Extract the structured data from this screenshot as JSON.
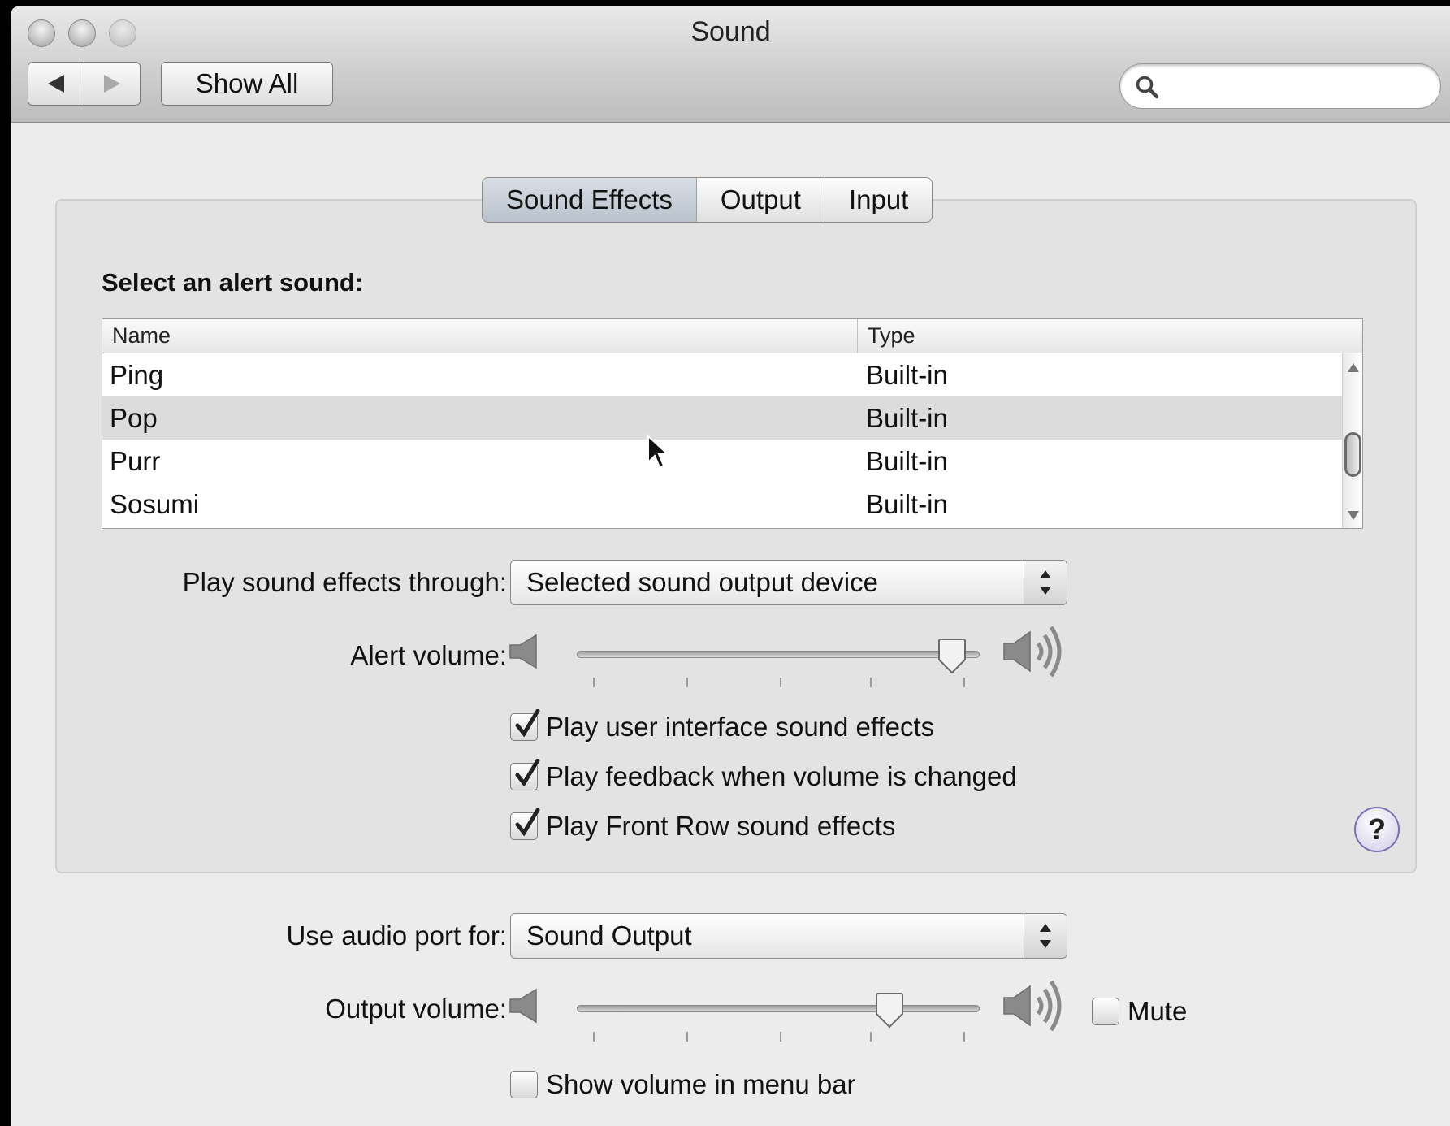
{
  "window": {
    "title": "Sound"
  },
  "toolbar": {
    "show_all_label": "Show All",
    "search_placeholder": ""
  },
  "tabs": [
    {
      "label": "Sound Effects",
      "active": true
    },
    {
      "label": "Output",
      "active": false
    },
    {
      "label": "Input",
      "active": false
    }
  ],
  "alert_section": {
    "title": "Select an alert sound:",
    "columns": {
      "name": "Name",
      "type": "Type"
    },
    "rows": [
      {
        "name": "Ping",
        "type": "Built-in",
        "selected": false
      },
      {
        "name": "Pop",
        "type": "Built-in",
        "selected": true
      },
      {
        "name": "Purr",
        "type": "Built-in",
        "selected": false
      },
      {
        "name": "Sosumi",
        "type": "Built-in",
        "selected": false
      }
    ]
  },
  "play_through": {
    "label": "Play sound effects through:",
    "value": "Selected sound output device"
  },
  "alert_volume": {
    "label": "Alert volume:",
    "level": 0.97
  },
  "checkboxes": [
    {
      "label": "Play user interface sound effects",
      "checked": true
    },
    {
      "label": "Play feedback when volume is changed",
      "checked": true
    },
    {
      "label": "Play Front Row sound effects",
      "checked": true
    }
  ],
  "help": {
    "label": "?"
  },
  "audio_port": {
    "label": "Use audio port for:",
    "value": "Sound Output"
  },
  "output_volume": {
    "label": "Output volume:",
    "level": 0.8,
    "mute_label": "Mute",
    "muted": false
  },
  "menu_bar": {
    "label": "Show volume in menu bar",
    "checked": false
  },
  "colors": {
    "selection_row": "#dcdcdc",
    "window_bg": "#ececec",
    "help_ring": "#7a6fb0"
  }
}
